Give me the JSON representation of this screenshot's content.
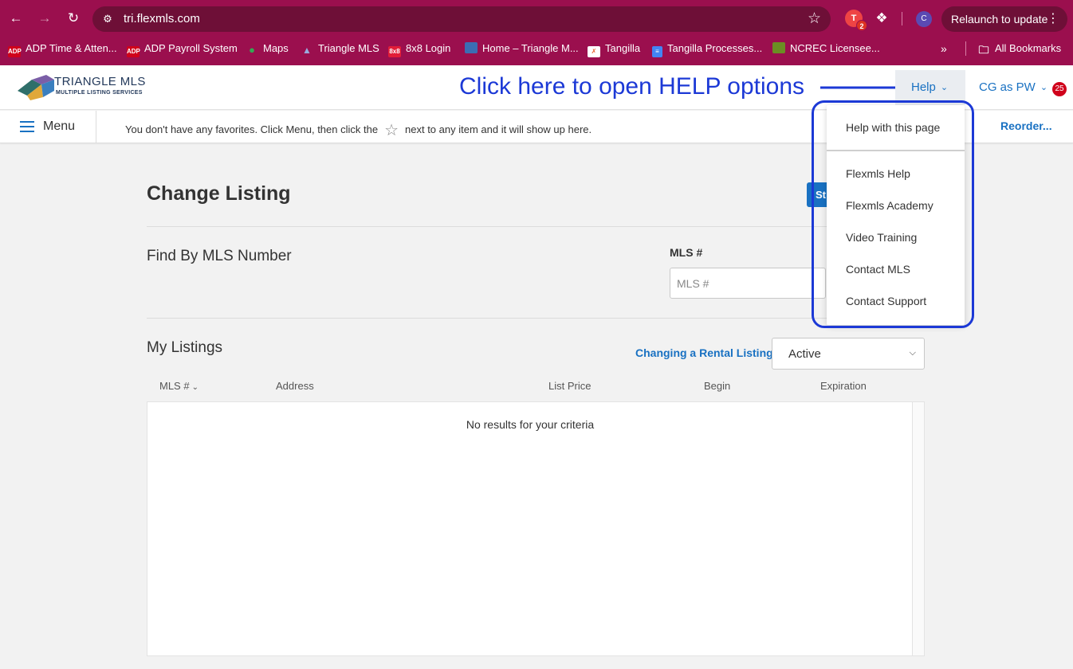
{
  "browser": {
    "url": "tri.flexmls.com",
    "extension_badge": "2",
    "profile_initial": "C",
    "relaunch_label": "Relaunch to update",
    "bookmarks": [
      {
        "label": "ADP Time & Atten...",
        "icon": "adp-icon",
        "color": "#d0021b",
        "text": "ADP"
      },
      {
        "label": "ADP Payroll System",
        "icon": "adp-icon",
        "color": "#d0021b",
        "text": "ADP"
      },
      {
        "label": "Maps",
        "icon": "maps-pin-icon",
        "color": "#34a853",
        "text": ""
      },
      {
        "label": "Triangle MLS",
        "icon": "triangle-mls-icon",
        "color": "#4a90e2",
        "text": ""
      },
      {
        "label": "8x8 Login",
        "icon": "8x8-icon",
        "color": "#e21d38",
        "text": "8x8"
      },
      {
        "label": "Home – Triangle M...",
        "icon": "triangle-mls-icon",
        "color": "#3b6db3",
        "text": ""
      },
      {
        "label": "Tangilla",
        "icon": "tangilla-icon",
        "color": "#e85d2a",
        "text": ""
      },
      {
        "label": "Tangilla Processes...",
        "icon": "docs-icon",
        "color": "#4285f4",
        "text": ""
      },
      {
        "label": "NCREC Licensee...",
        "icon": "ncrec-icon",
        "color": "#6b8e23",
        "text": ""
      }
    ],
    "more_glyph": "»",
    "all_bookmarks_label": "All Bookmarks"
  },
  "header": {
    "logo_main": "TRIANGLE MLS",
    "logo_sub": "MULTIPLE LISTING SERVICES",
    "annotation": "Click here to open HELP options",
    "help_label": "Help",
    "user_label": "CG as PW",
    "notification_count": "25"
  },
  "favorites": {
    "menu_label": "Menu",
    "text_before": "You don't have any favorites. Click Menu, then click the",
    "text_after": "next to any item and it will show up here.",
    "reorder_label": "Reorder..."
  },
  "main": {
    "title": "Change Listing",
    "start_button_label": "St",
    "find_title": "Find By MLS Number",
    "mls_label": "MLS #",
    "mls_placeholder": "MLS #",
    "mls_value": "",
    "my_listings_title": "My Listings",
    "rental_link": "Changing a Rental Listing?",
    "status_selected": "Active",
    "columns": [
      "MLS #",
      "Address",
      "List Price",
      "Begin",
      "Expiration"
    ],
    "empty_message": "No results for your criteria"
  },
  "help_menu": {
    "items": [
      "Help with this page",
      "Flexmls Help",
      "Flexmls Academy",
      "Video Training",
      "Contact MLS",
      "Contact Support"
    ]
  },
  "colors": {
    "chrome": "#9b0f4e",
    "link_blue": "#1971c2",
    "annotation_blue": "#1c39d6",
    "badge_red": "#d0021b"
  }
}
